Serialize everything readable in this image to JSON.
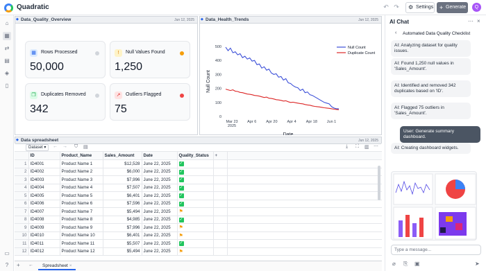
{
  "app": {
    "name": "Quadratic",
    "settings_label": "Settings",
    "generate_label": "Generate",
    "avatar_initial": "Q"
  },
  "panels": {
    "overview": {
      "title": "Data_Quality_Overview",
      "date": "Jun 12, 2025"
    },
    "trends": {
      "title": "Data_Health_Trends",
      "date": "Jun 12, 2025"
    },
    "sheet": {
      "title": "Data spreadsheet",
      "date": "Jun 12, 2025"
    }
  },
  "cards": [
    {
      "label": "Rows Processed",
      "value": "50,000",
      "dot_color": "#d1d5db",
      "icon": "table-icon"
    },
    {
      "label": "Null Values Found",
      "value": "1,250",
      "dot_color": "#f59e0b",
      "icon": "warning-icon"
    },
    {
      "label": "Duplicates Removed",
      "value": "342",
      "dot_color": "#d1d5db",
      "icon": "copy-icon"
    },
    {
      "label": "Outliers Flagged",
      "value": "75",
      "dot_color": "#ef4444",
      "icon": "trend-icon"
    }
  ],
  "chart_data": {
    "type": "line",
    "xlabel": "Date",
    "ylabel": "Null Count",
    "ylim": [
      0,
      500
    ],
    "yticks": [
      "500",
      "400",
      "300",
      "200",
      "100",
      "0"
    ],
    "xticks": [
      "Mar 23\n2025",
      "Apr 6",
      "Apr 20",
      "Apr 4",
      "Apr 18",
      "Jun 1"
    ],
    "legend_position": "top-right",
    "series": [
      {
        "name": "Null Count",
        "color": "#3b4fd8",
        "values": [
          495,
          470,
          488,
          455,
          462,
          440,
          448,
          420,
          430,
          410,
          418,
          395,
          400,
          370,
          375,
          345,
          355,
          330,
          338,
          310,
          300,
          305,
          280,
          285,
          260,
          270,
          240,
          235,
          220,
          210,
          205,
          185,
          195,
          170,
          175,
          155,
          150,
          140,
          130,
          120,
          110,
          100,
          95,
          90,
          70,
          60,
          55,
          55
        ]
      },
      {
        "name": "Duplicate Count",
        "color": "#dc2626",
        "values": [
          195,
          190,
          185,
          190,
          180,
          178,
          172,
          170,
          165,
          160,
          158,
          155,
          150,
          148,
          145,
          140,
          135,
          138,
          130,
          128,
          125,
          120,
          118,
          115,
          110,
          112,
          105,
          100,
          102,
          98,
          95,
          92,
          90,
          85,
          82,
          80,
          75,
          72,
          70,
          68,
          65,
          62,
          60,
          58,
          55,
          52,
          50,
          48
        ]
      }
    ]
  },
  "sheet": {
    "tab_label": "Spreadsheet",
    "table_name": "Dataset",
    "columns": [
      "ID",
      "Product_Name",
      "Sales_Amount",
      "Date",
      "Quality_Status"
    ],
    "rows": [
      {
        "n": "1",
        "id": "ID4001",
        "name": "Product Name 1",
        "amt": "$12,528",
        "date": "June 22, 2025",
        "status": "ok"
      },
      {
        "n": "2",
        "id": "ID4002",
        "name": "Product Name 2",
        "amt": "$6,000",
        "date": "June 22, 2025",
        "status": "ok"
      },
      {
        "n": "3",
        "id": "ID4003",
        "name": "Product Name 3",
        "amt": "$7,996",
        "date": "June 22, 2025",
        "status": "ok"
      },
      {
        "n": "4",
        "id": "ID4004",
        "name": "Product Name 4",
        "amt": "$7,507",
        "date": "June 22, 2025",
        "status": "ok"
      },
      {
        "n": "5",
        "id": "ID4005",
        "name": "Product Name 5",
        "amt": "$6,401",
        "date": "June 22, 2025",
        "status": "ok"
      },
      {
        "n": "6",
        "id": "ID4006",
        "name": "Product Name 6",
        "amt": "$7,596",
        "date": "June 22, 2025",
        "status": "ok"
      },
      {
        "n": "7",
        "id": "ID4007",
        "name": "Product Name 7",
        "amt": "$5,494",
        "date": "June 22, 2025",
        "status": "flag"
      },
      {
        "n": "8",
        "id": "ID4008",
        "name": "Product Name 8",
        "amt": "$4,985",
        "date": "June 22, 2025",
        "status": "ok"
      },
      {
        "n": "9",
        "id": "ID4009",
        "name": "Product Name 9",
        "amt": "$7,996",
        "date": "June 22, 2025",
        "status": "flag"
      },
      {
        "n": "10",
        "id": "ID4010",
        "name": "Product Name 10",
        "amt": "$6,401",
        "date": "June 22, 2025",
        "status": "flag"
      },
      {
        "n": "11",
        "id": "ID4011",
        "name": "Product Name 11",
        "amt": "$5,507",
        "date": "June 22, 2025",
        "status": "ok"
      },
      {
        "n": "12",
        "id": "ID4012",
        "name": "Product Name 12",
        "amt": "$5,494",
        "date": "June 22, 2025",
        "status": "flag"
      }
    ]
  },
  "chat": {
    "title": "AI Chat",
    "thread_title": "Automated Data Quality Checklist",
    "messages": [
      {
        "role": "ai",
        "text": "AI: Analyzing dataset for quality issues."
      },
      {
        "role": "ai",
        "text": "AI: Found 1,250 null values in 'Sales_Amount'."
      },
      {
        "role": "ai",
        "text": "AI: Identified and removed 342 duplicates based on 'ID'."
      },
      {
        "role": "ai",
        "text": "AI: Flagged 75 outliers in 'Sales_Amount'."
      },
      {
        "role": "user",
        "text": "User: Generate summary dashboard."
      },
      {
        "role": "ai",
        "text": "AI: Creating dashboard widgets."
      }
    ],
    "input_placeholder": "Type a message..."
  }
}
